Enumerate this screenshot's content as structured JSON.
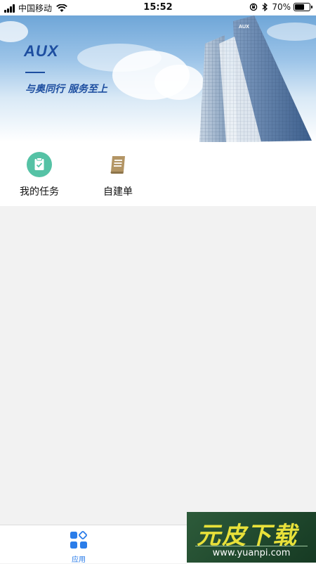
{
  "status_bar": {
    "carrier": "中国移动",
    "time": "15:52",
    "battery": "70%",
    "battery_level": 0.7
  },
  "banner": {
    "brand": "AUX",
    "slogan": "与奥同行 服务至上",
    "building_sign": "AUX"
  },
  "shortcuts": [
    {
      "label": "我的任务",
      "icon": "clipboard-check-icon",
      "color": "#55c2a5"
    },
    {
      "label": "自建单",
      "icon": "book-icon",
      "color": "#b39565"
    }
  ],
  "tab_bar": {
    "apps_label": "应用",
    "active_color": "#2b7de9"
  },
  "watermark": {
    "title": "元皮下载",
    "url": "www.yuanpi.com"
  }
}
